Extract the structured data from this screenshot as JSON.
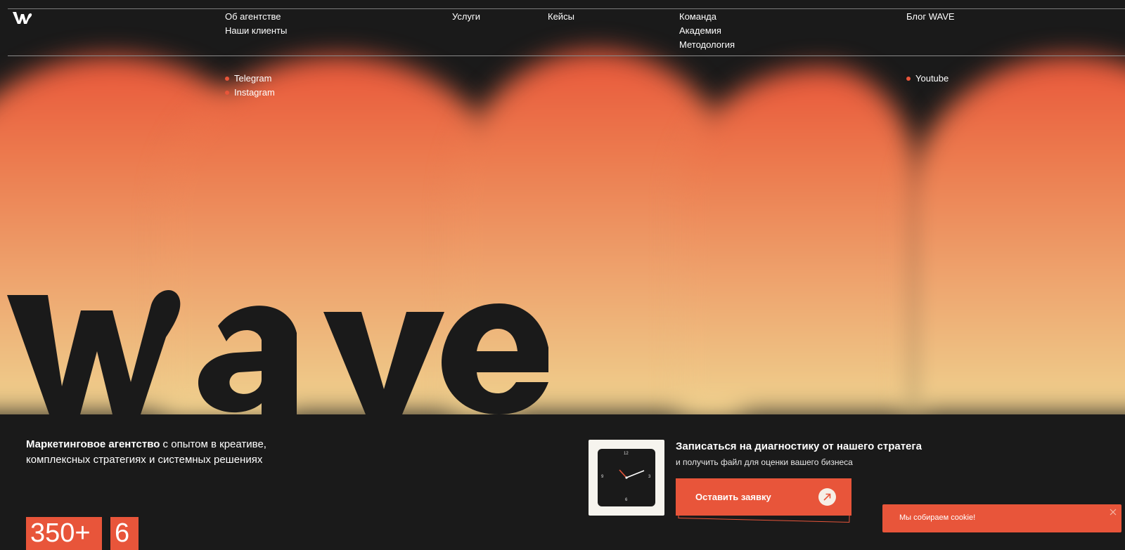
{
  "nav": {
    "columns": [
      [
        "Об агентстве",
        "Наши клиенты"
      ],
      [
        "Услуги"
      ],
      [
        "Кейсы"
      ],
      [
        "Команда",
        "Академия",
        "Методология"
      ],
      [
        "Блог WAVE"
      ]
    ]
  },
  "social": {
    "items": [
      "Telegram",
      "Instagram",
      "Youtube"
    ]
  },
  "hero": {
    "tagline_bold": "Маркетинговое агентство",
    "tagline_rest": " с опытом в креативе, комплексных стратегиях и системных решениях"
  },
  "stats": [
    "350+",
    "6"
  ],
  "cta": {
    "title": "Записаться на диагностику от нашего стратега",
    "subtitle": "и получить файл для оценки вашего бизнеса",
    "button_label": "Оставить заявку",
    "clock_numbers": [
      "12",
      "3",
      "6",
      "9"
    ]
  },
  "cookie": {
    "text": "Мы собираем cookie!"
  },
  "colors": {
    "accent": "#e8553a",
    "background": "#1a1a1a"
  }
}
